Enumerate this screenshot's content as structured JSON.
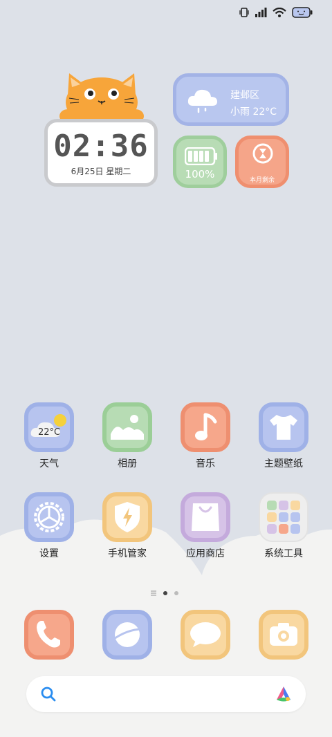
{
  "clock_widget": {
    "time": "02:36",
    "date": "6月25日 星期二"
  },
  "weather_widget": {
    "location": "建邺区",
    "condition": "小雨  22°C"
  },
  "battery_widget": {
    "percent": "100%",
    "level": 1.0
  },
  "month_widget": {
    "label": "本月剩余"
  },
  "apps_row1": [
    {
      "label": "天气",
      "badge": "22°C"
    },
    {
      "label": "相册"
    },
    {
      "label": "音乐"
    },
    {
      "label": "主题壁纸"
    }
  ],
  "apps_row2": [
    {
      "label": "设置"
    },
    {
      "label": "手机管家"
    },
    {
      "label": "应用商店"
    },
    {
      "label": "系统工具"
    }
  ],
  "page_indicator": {
    "pages": 2,
    "active": 1
  },
  "dock": [
    {
      "icon": "phone-icon"
    },
    {
      "icon": "browser-icon"
    },
    {
      "icon": "messages-icon"
    },
    {
      "icon": "camera-icon"
    }
  ],
  "colors": {
    "background": "#dde1e8",
    "blue": "#b7c4ef",
    "green": "#b7dcb4",
    "orange": "#f6a78b",
    "yellow": "#f9d8a1",
    "purple": "#d6c3e7"
  }
}
